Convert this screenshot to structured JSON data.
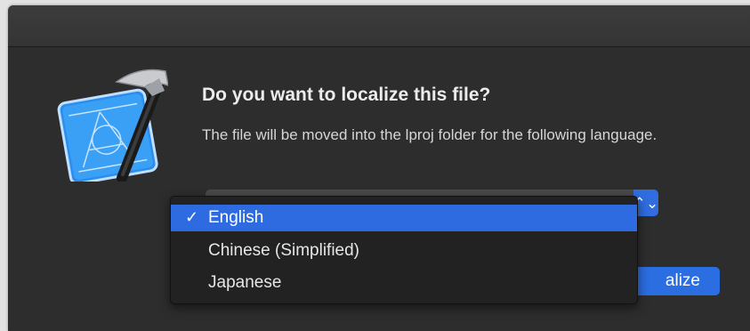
{
  "dialog": {
    "title": "Do you want to localize this file?",
    "message": "The file will be moved into the lproj folder for the following language.",
    "app_icon": "xcode-icon"
  },
  "language_popup": {
    "selected": "English",
    "stepper_icon": "up-down-chevron-icon",
    "stepper_glyph": "⌃⌄",
    "options": [
      {
        "label": "English",
        "checked": true,
        "check_glyph": "✓"
      },
      {
        "label": "Chinese (Simplified)",
        "checked": false
      },
      {
        "label": "Japanese",
        "checked": false
      }
    ]
  },
  "buttons": {
    "localize_label_visible": "alize"
  },
  "colors": {
    "accent": "#2e6ae0",
    "dialog_background": "#2e2d2e",
    "menu_background": "#222223"
  }
}
